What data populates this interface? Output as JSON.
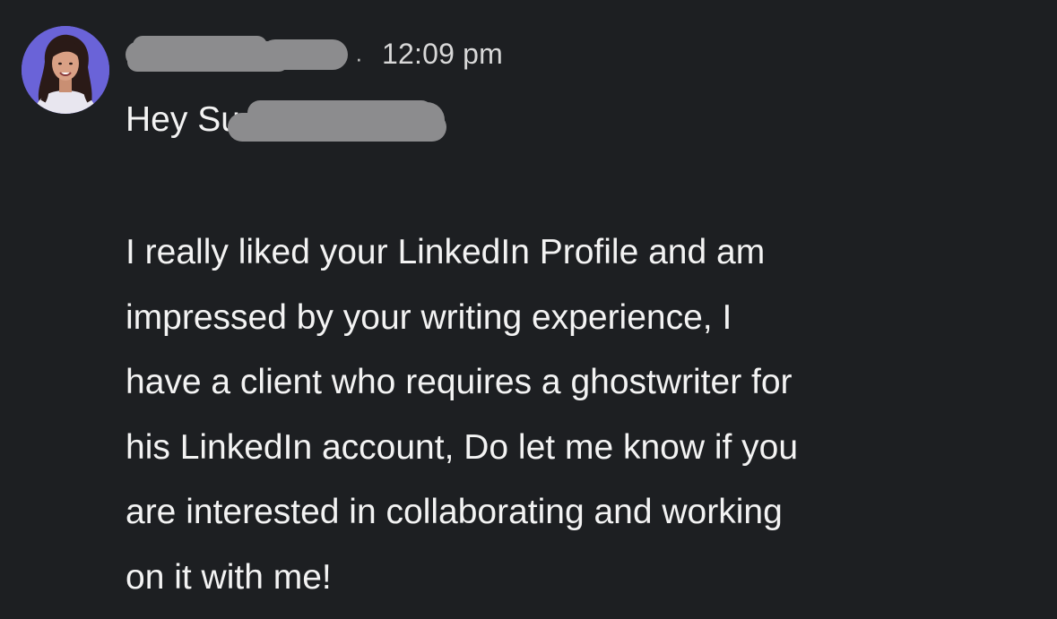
{
  "message": {
    "sender": {
      "avatar": "profile-photo",
      "name_redacted": true
    },
    "separator": "·",
    "timestamp": "12:09 pm",
    "greeting": "Hey Su",
    "body_lines": [
      "I really liked your LinkedIn Profile and am",
      "impressed by your writing experience, I",
      "have a client who requires a ghostwriter for",
      "his LinkedIn account, Do let me know if you",
      "are interested in collaborating and working",
      "on it with me!"
    ]
  },
  "colors": {
    "background": "#1d1f22",
    "text": "#f3f3f3",
    "timestamp": "#d8d8d8",
    "redaction": "#8c8c8e",
    "avatar_bg": "#6a63d8"
  }
}
